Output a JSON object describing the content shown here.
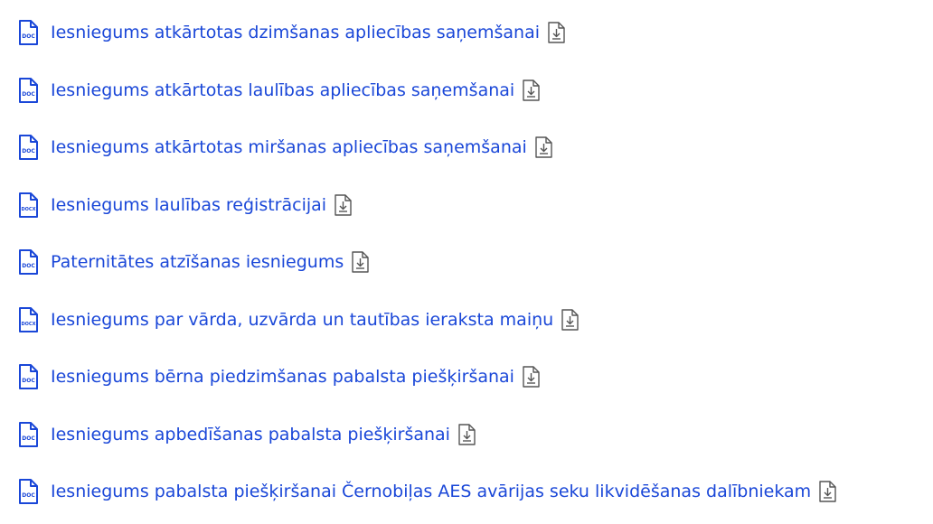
{
  "documents": [
    {
      "title": "Iesniegums atkārtotas dzimšanas apliecības saņemšanai",
      "file_type": "DOC",
      "icon": "doc-file-icon",
      "action_icon": "download-icon"
    },
    {
      "title": "Iesniegums atkārtotas laulības apliecības saņemšanai",
      "file_type": "DOC",
      "icon": "doc-file-icon",
      "action_icon": "download-icon"
    },
    {
      "title": "Iesniegums atkārtotas miršanas apliecības saņemšanai",
      "file_type": "DOC",
      "icon": "doc-file-icon",
      "action_icon": "download-icon"
    },
    {
      "title": "Iesniegums laulības reģistrācijai",
      "file_type": "DOCX",
      "icon": "docx-file-icon",
      "action_icon": "download-icon"
    },
    {
      "title": "Paternitātes atzīšanas iesniegums",
      "file_type": "DOC",
      "icon": "doc-file-icon",
      "action_icon": "download-icon"
    },
    {
      "title": "Iesniegums par vārda, uzvārda un tautības ieraksta maiņu",
      "file_type": "DOCX",
      "icon": "docx-file-icon",
      "action_icon": "download-icon"
    },
    {
      "title": "Iesniegums bērna piedzimšanas pabalsta piešķiršanai",
      "file_type": "DOC",
      "icon": "doc-file-icon",
      "action_icon": "download-icon"
    },
    {
      "title": "Iesniegums apbedīšanas pabalsta piešķiršanai",
      "file_type": "DOC",
      "icon": "doc-file-icon",
      "action_icon": "download-icon"
    },
    {
      "title": "Iesniegums pabalsta piešķiršanai Černobiļas AES avārijas seku likvidēšanas dalībniekam",
      "file_type": "DOC",
      "icon": "doc-file-icon",
      "action_icon": "download-icon"
    }
  ],
  "colors": {
    "link": "#1a47d8",
    "icon": "#1a47d8",
    "download_icon": "#555555"
  }
}
